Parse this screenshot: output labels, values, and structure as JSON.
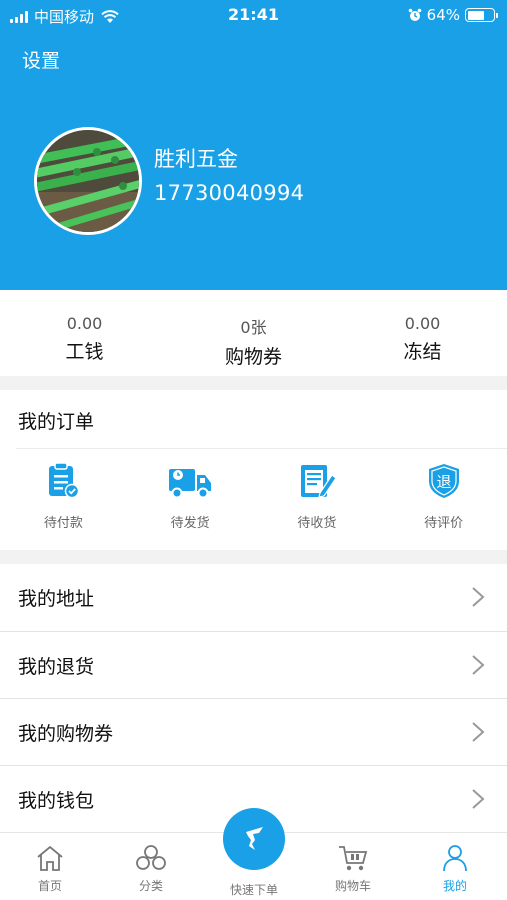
{
  "status_bar": {
    "carrier": "中国移动",
    "time": "21:41",
    "battery": "64%",
    "battery_level": 0.64
  },
  "header": {
    "settings_label": "设置"
  },
  "user": {
    "name": "胜利五金",
    "phone": "17730040994"
  },
  "stats": [
    {
      "value": "0.00",
      "label": "工钱"
    },
    {
      "value": "0张",
      "label": "购物券"
    },
    {
      "value": "0.00",
      "label": "冻结"
    }
  ],
  "orders": {
    "title": "我的订单",
    "items": [
      {
        "label": "待付款",
        "icon": "payment-clipboard-icon"
      },
      {
        "label": "待发货",
        "icon": "delivery-truck-icon"
      },
      {
        "label": "待收货",
        "icon": "receipt-edit-icon"
      },
      {
        "label": "待评价",
        "icon": "return-shield-icon",
        "icon_text": "退"
      }
    ]
  },
  "menu": [
    {
      "label": "我的地址"
    },
    {
      "label": "我的退货"
    },
    {
      "label": "我的购物券"
    },
    {
      "label": "我的钱包"
    }
  ],
  "tabbar": {
    "items": [
      {
        "label": "首页",
        "icon": "home-icon"
      },
      {
        "label": "分类",
        "icon": "category-icon"
      },
      {
        "label": "快速下单",
        "icon": "quick-order-icon"
      },
      {
        "label": "购物车",
        "icon": "cart-icon"
      },
      {
        "label": "我的",
        "icon": "user-icon"
      }
    ],
    "active": "我的"
  },
  "colors": {
    "primary": "#1aa0e6",
    "background": "#f2f2f2",
    "text": "#222222"
  }
}
